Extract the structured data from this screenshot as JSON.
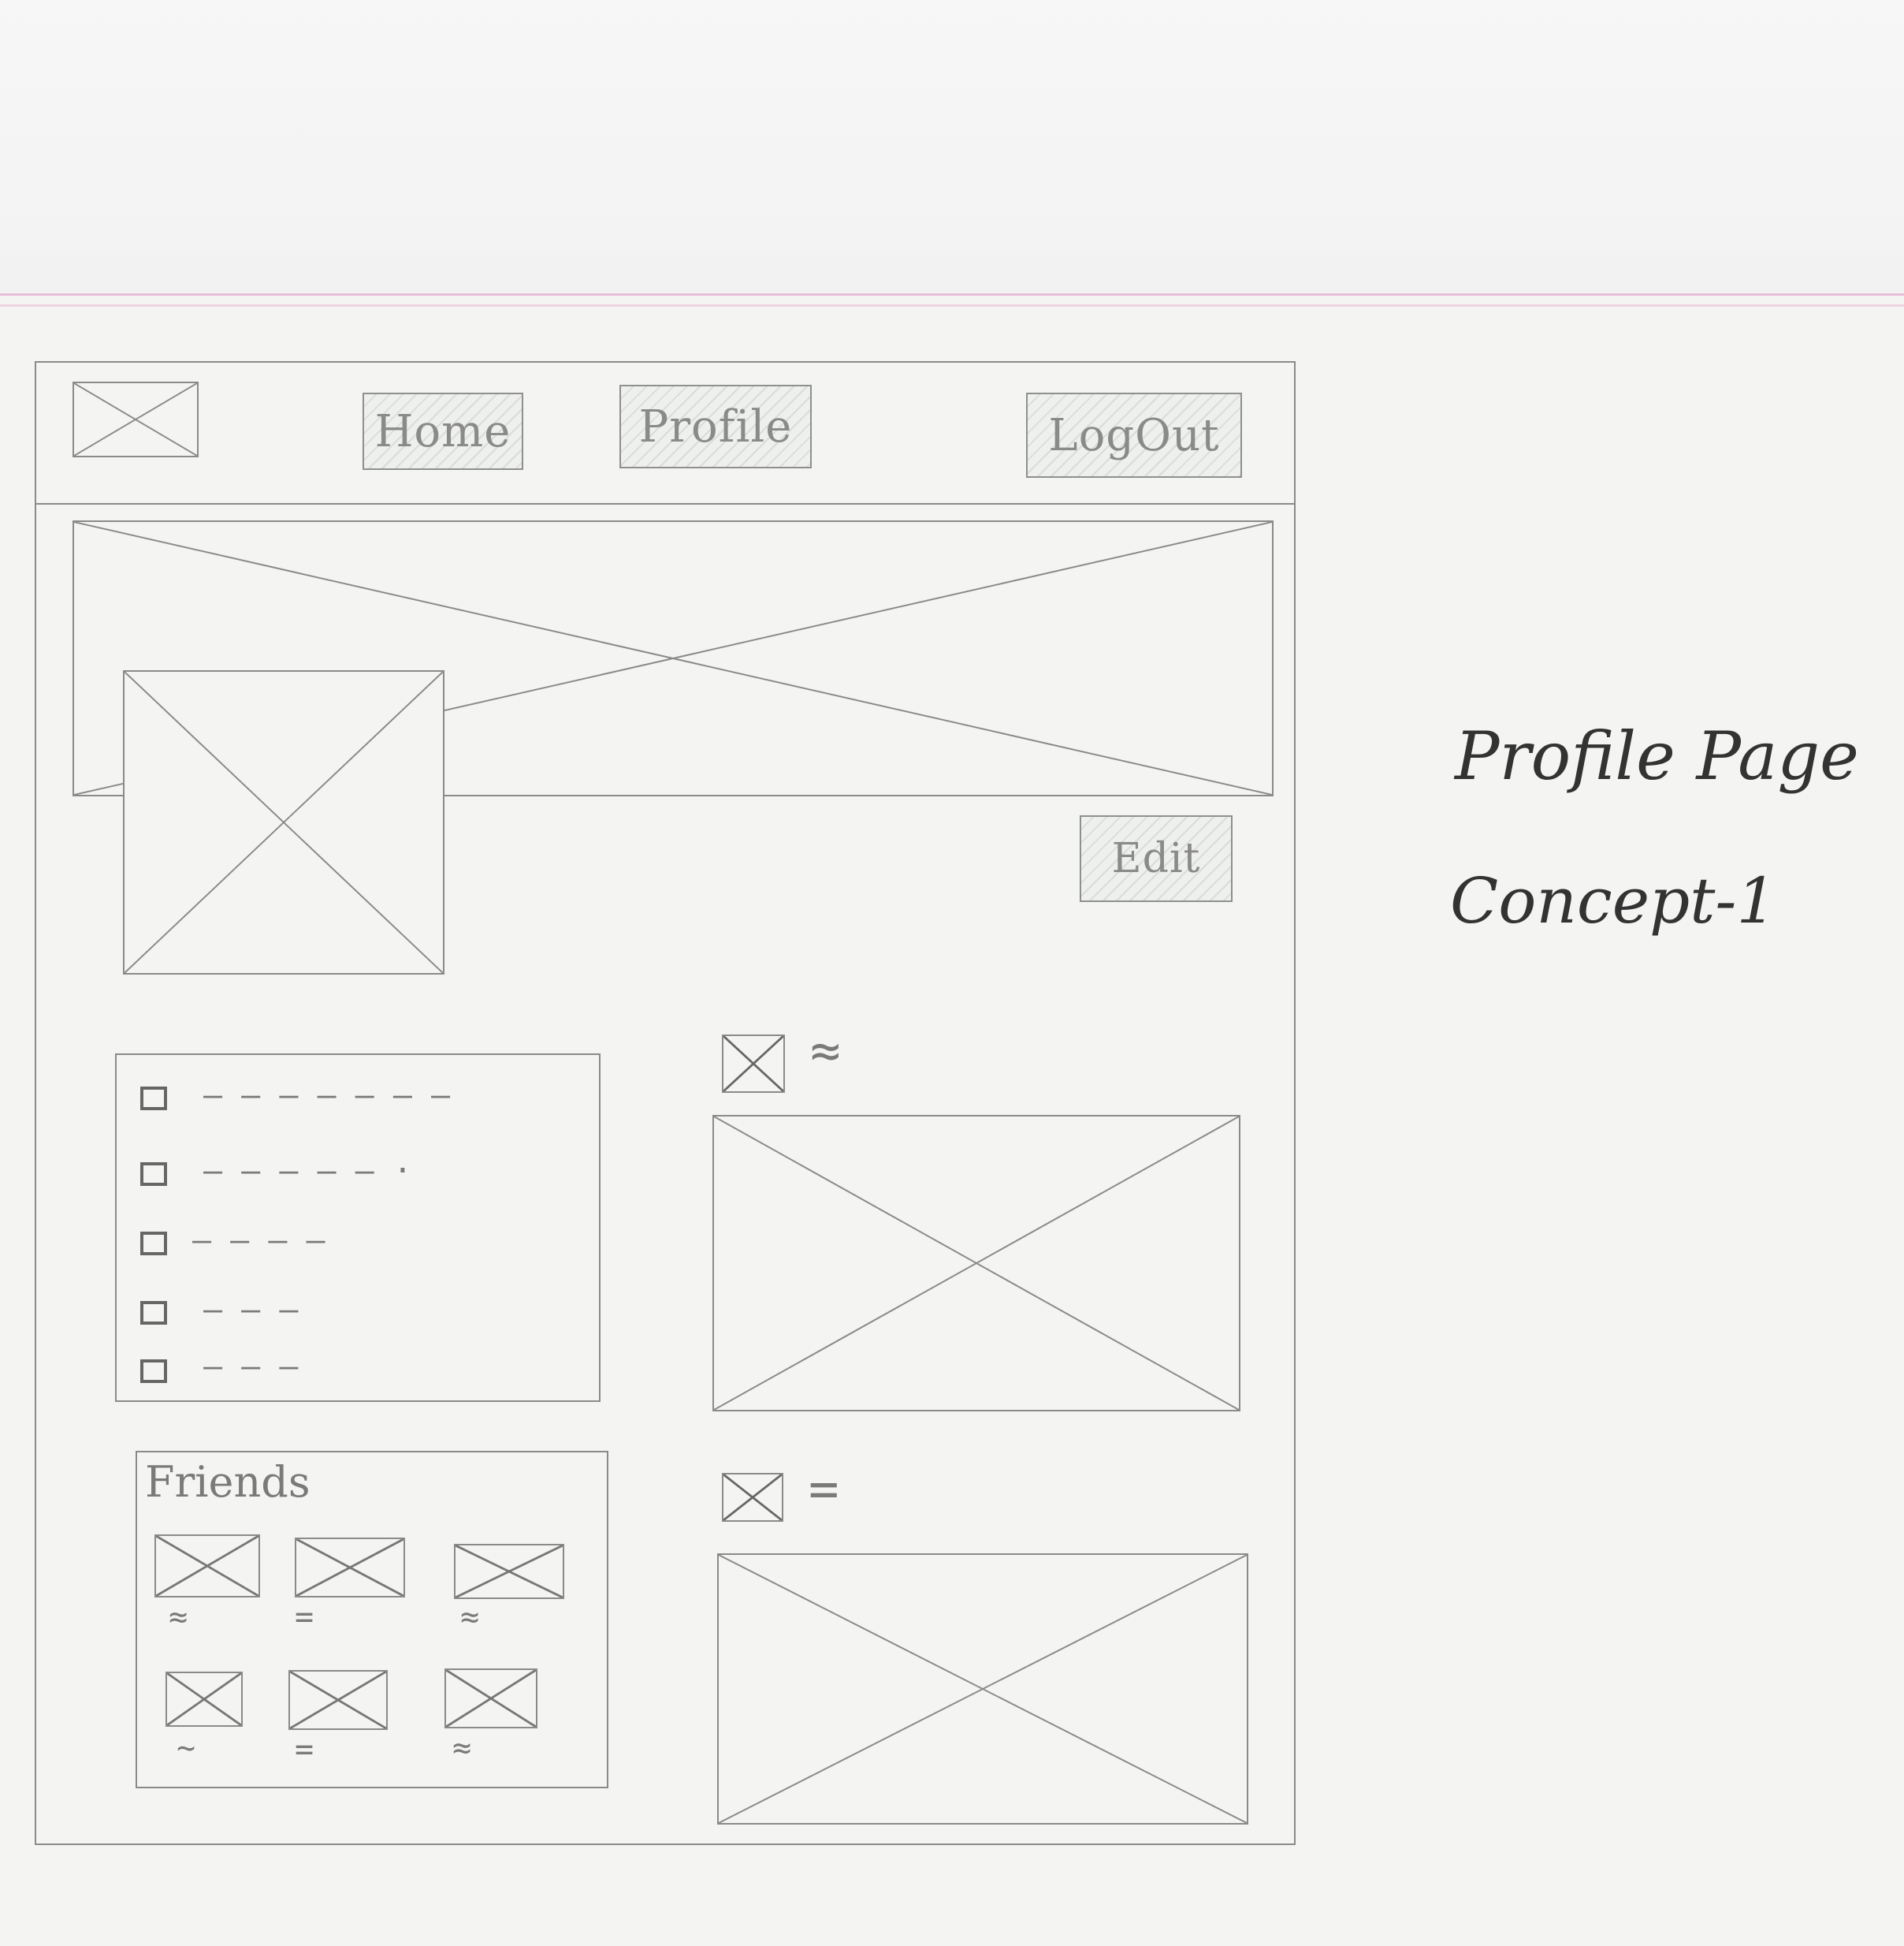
{
  "nav": {
    "home_label": "Home",
    "profile_label": "Profile",
    "logout_label": "LogOut"
  },
  "profile": {
    "edit_label": "Edit"
  },
  "friends": {
    "title": "Friends",
    "items": [
      "≈",
      "=",
      "≈",
      "~",
      "=",
      "≈"
    ]
  },
  "posts": [
    {
      "heading": "≈"
    },
    {
      "heading": "="
    }
  ],
  "list_items": [
    "— — — — — — —",
    "— — — — — ·",
    "— — — —",
    "— — —",
    "— — —"
  ],
  "note": {
    "line1": "Profile Page",
    "line2": "Concept-1"
  }
}
